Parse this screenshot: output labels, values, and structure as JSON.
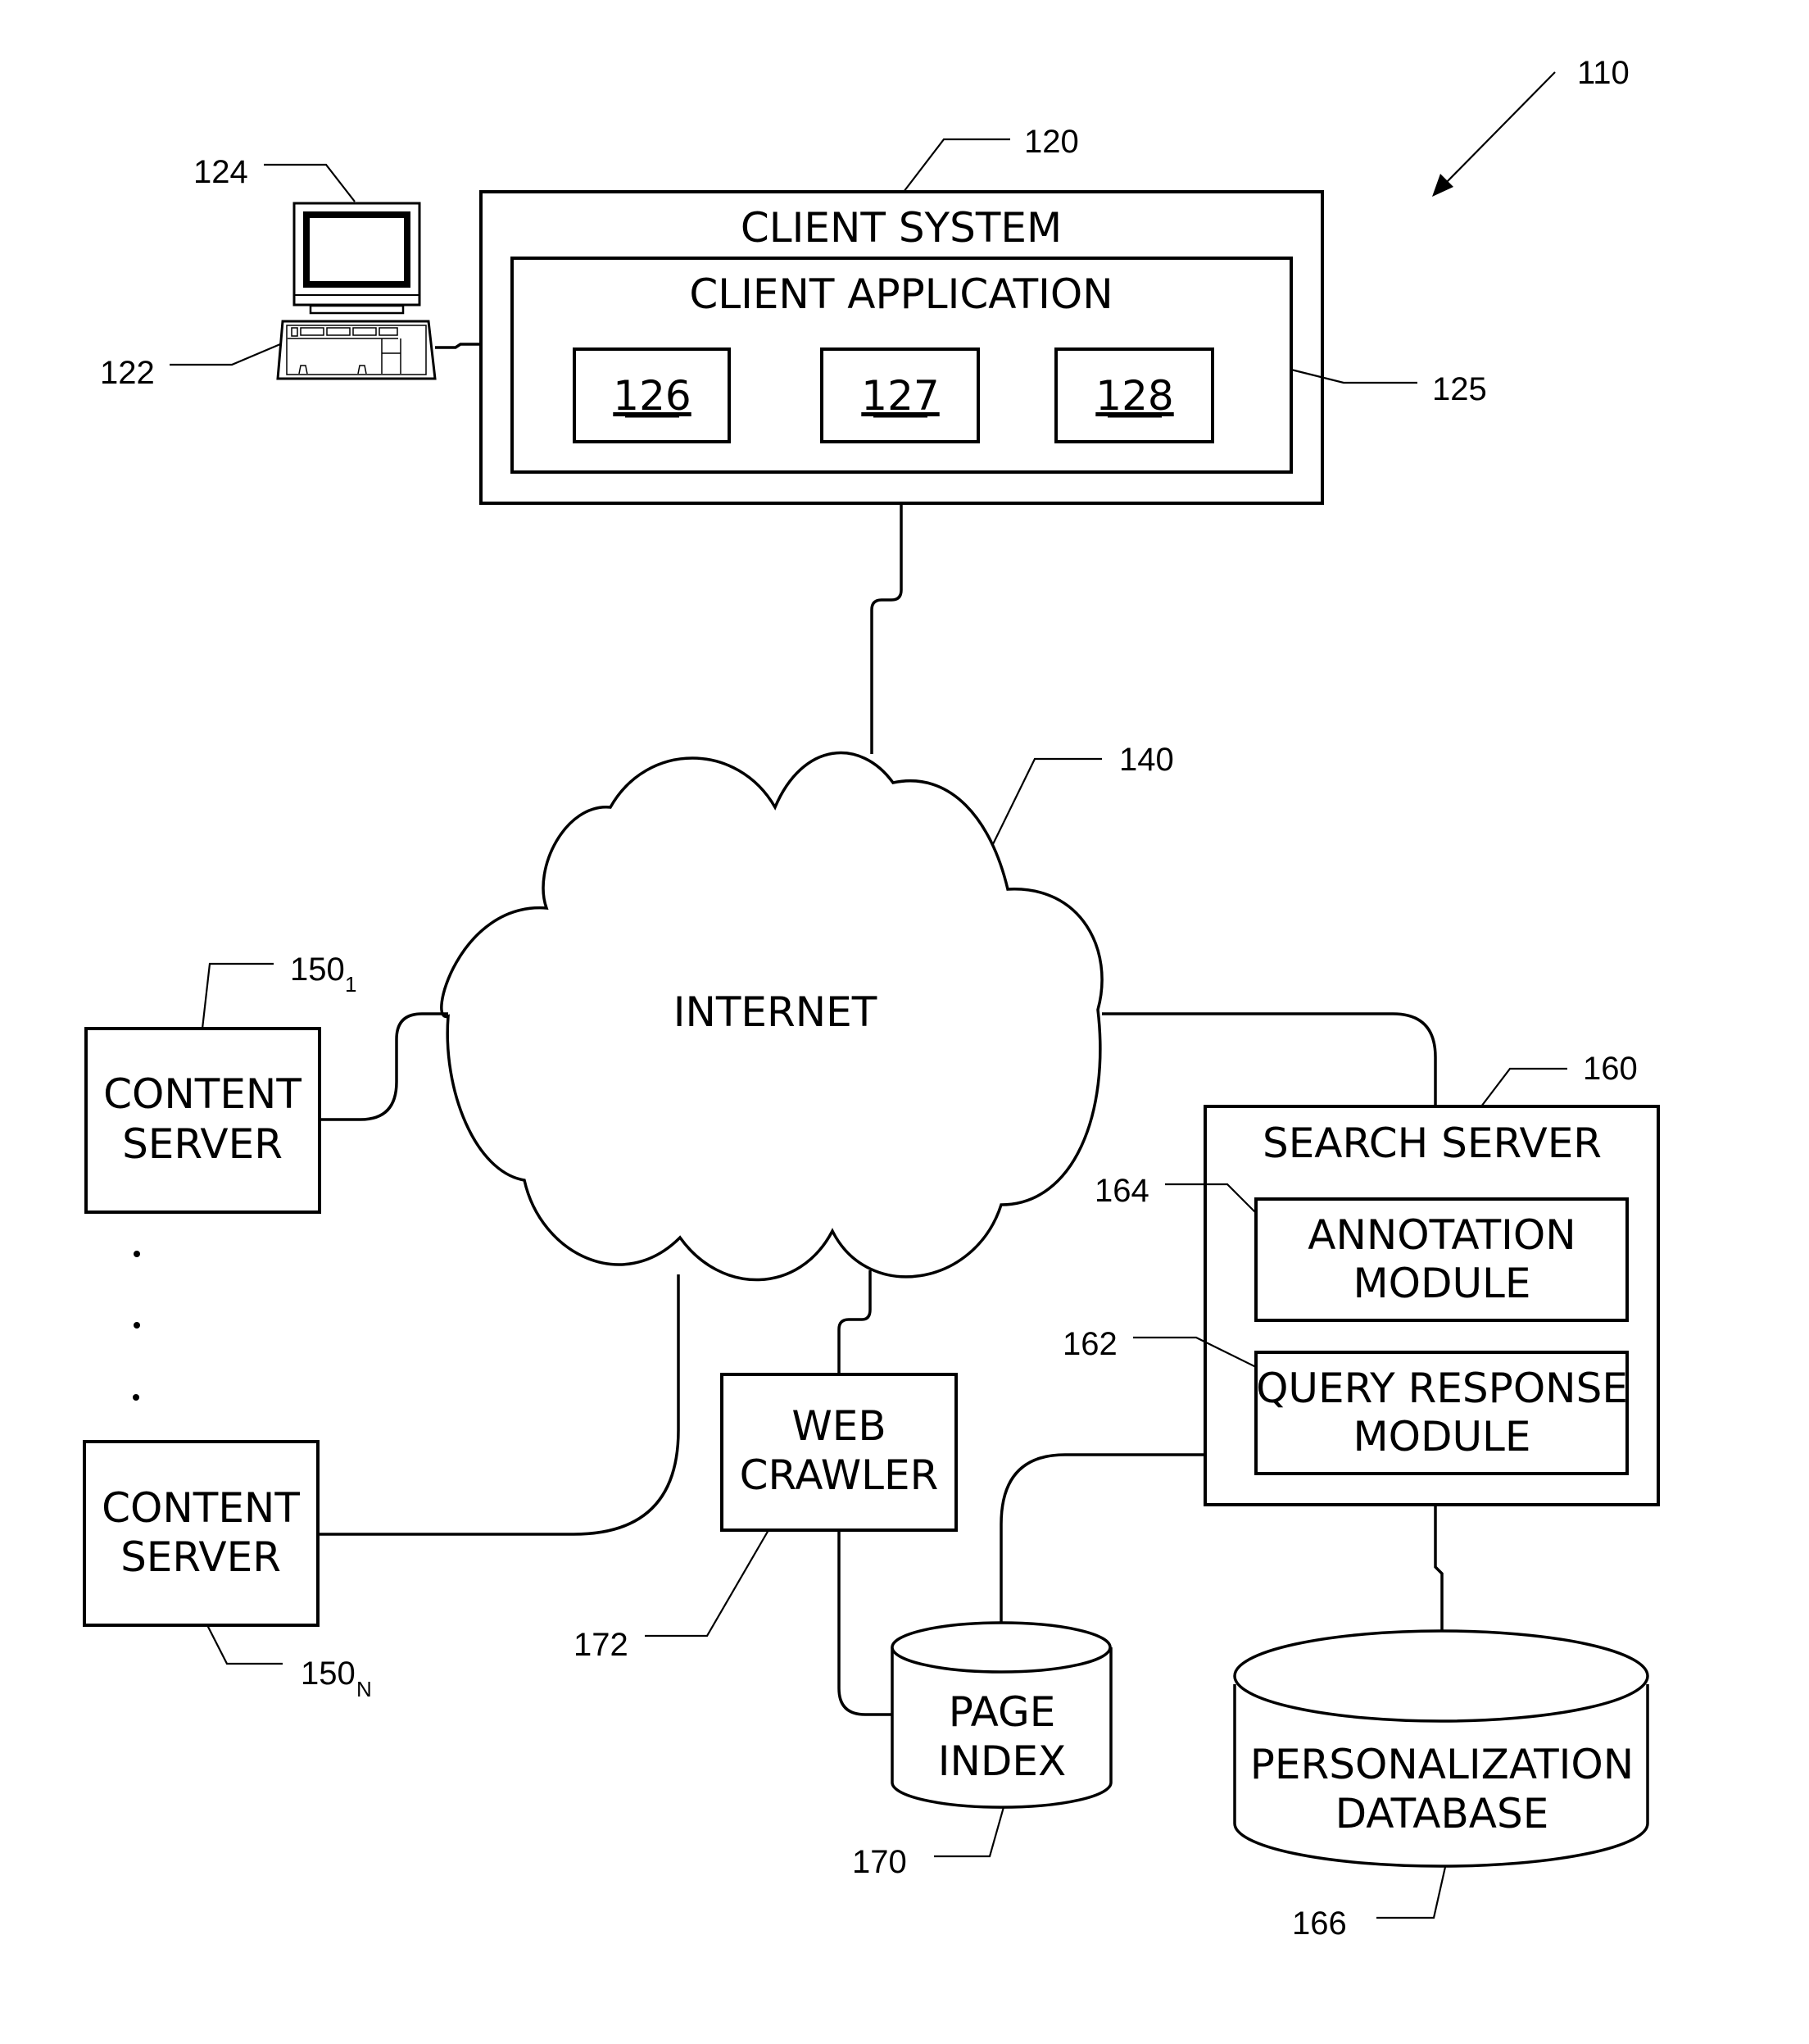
{
  "figure": {
    "ref_system": "110",
    "client_system": {
      "ref": "120",
      "title": "CLIENT SYSTEM",
      "application": {
        "ref": "125",
        "title": "CLIENT APPLICATION",
        "modules": [
          "126",
          "127",
          "128"
        ]
      },
      "computer": {
        "monitor_ref": "124",
        "keyboard_ref": "122"
      }
    },
    "internet": {
      "ref": "140",
      "label": "INTERNET"
    },
    "content_servers": [
      {
        "label_line1": "CONTENT",
        "label_line2": "SERVER",
        "ref_base": "150",
        "ref_sub": "1"
      },
      {
        "label_line1": "CONTENT",
        "label_line2": "SERVER",
        "ref_base": "150",
        "ref_sub": "N"
      }
    ],
    "search_server": {
      "ref": "160",
      "title": "SEARCH SERVER",
      "annotation_module": {
        "ref": "164",
        "line1": "ANNOTATION",
        "line2": "MODULE"
      },
      "query_response_module": {
        "ref": "162",
        "line1": "QUERY RESPONSE",
        "line2": "MODULE"
      }
    },
    "web_crawler": {
      "ref": "172",
      "line1": "WEB",
      "line2": "CRAWLER"
    },
    "page_index": {
      "ref": "170",
      "line1": "PAGE",
      "line2": "INDEX"
    },
    "personalization_db": {
      "ref": "166",
      "line1": "PERSONALIZATION",
      "line2": "DATABASE"
    }
  }
}
